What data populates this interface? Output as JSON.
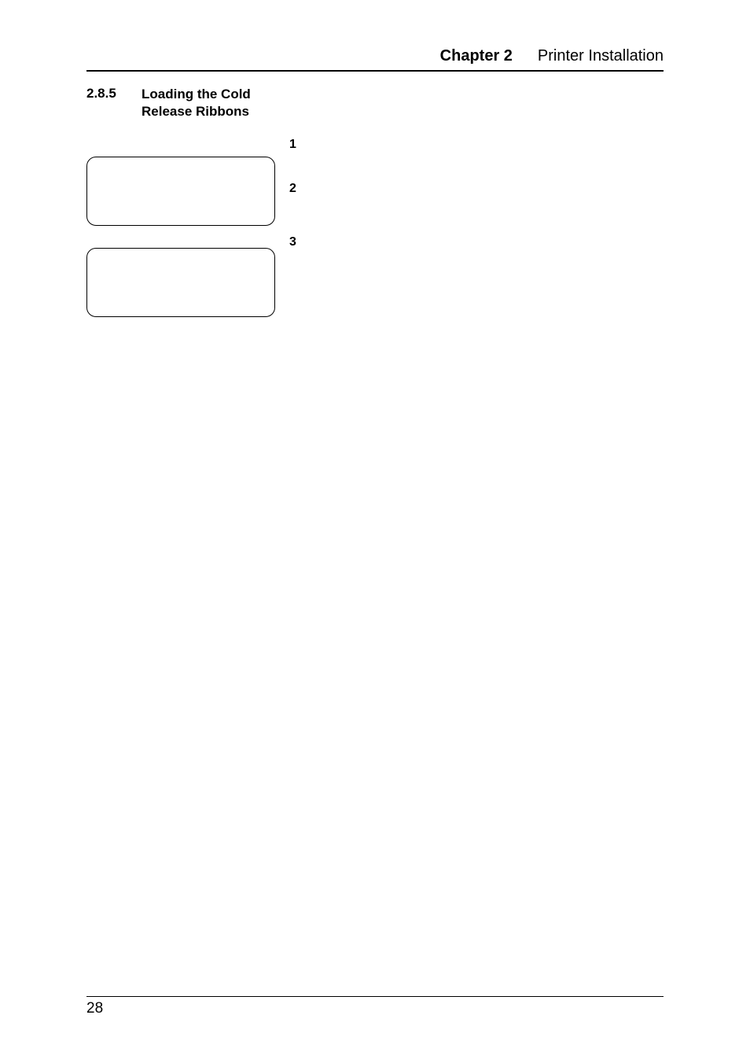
{
  "header": {
    "chapter_label": "Chapter 2",
    "chapter_title": "Printer Installation"
  },
  "section": {
    "number": "2.8.5",
    "title": "Loading the Cold Release Ribbons"
  },
  "steps": {
    "s1": "1",
    "s2": "2",
    "s3": "3"
  },
  "footer": {
    "page": "28"
  }
}
